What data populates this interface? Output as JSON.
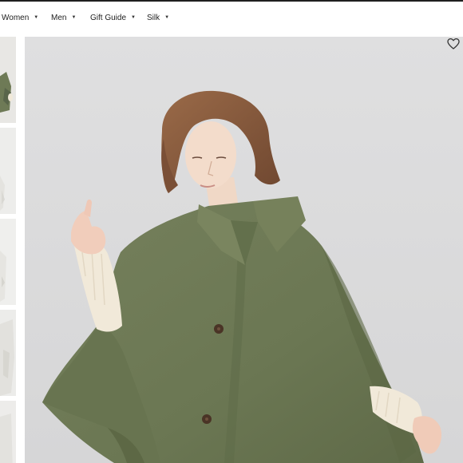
{
  "nav": {
    "items": [
      {
        "label": "Women"
      },
      {
        "label": "Men"
      },
      {
        "label": "Gift Guide"
      },
      {
        "label": "Silk"
      }
    ]
  },
  "icons": {
    "caret": "caret-down-icon",
    "favorite": "heart-icon"
  },
  "gallery": {
    "thumbnail_count": 5,
    "selected_index": 0
  },
  "colors": {
    "background": "#ffffff",
    "photo_background": "#dcdcdd",
    "cape": "#6e7a56",
    "sweater": "#f1e9d9",
    "hair": "#8a5a3c",
    "nav_text": "#222222"
  }
}
